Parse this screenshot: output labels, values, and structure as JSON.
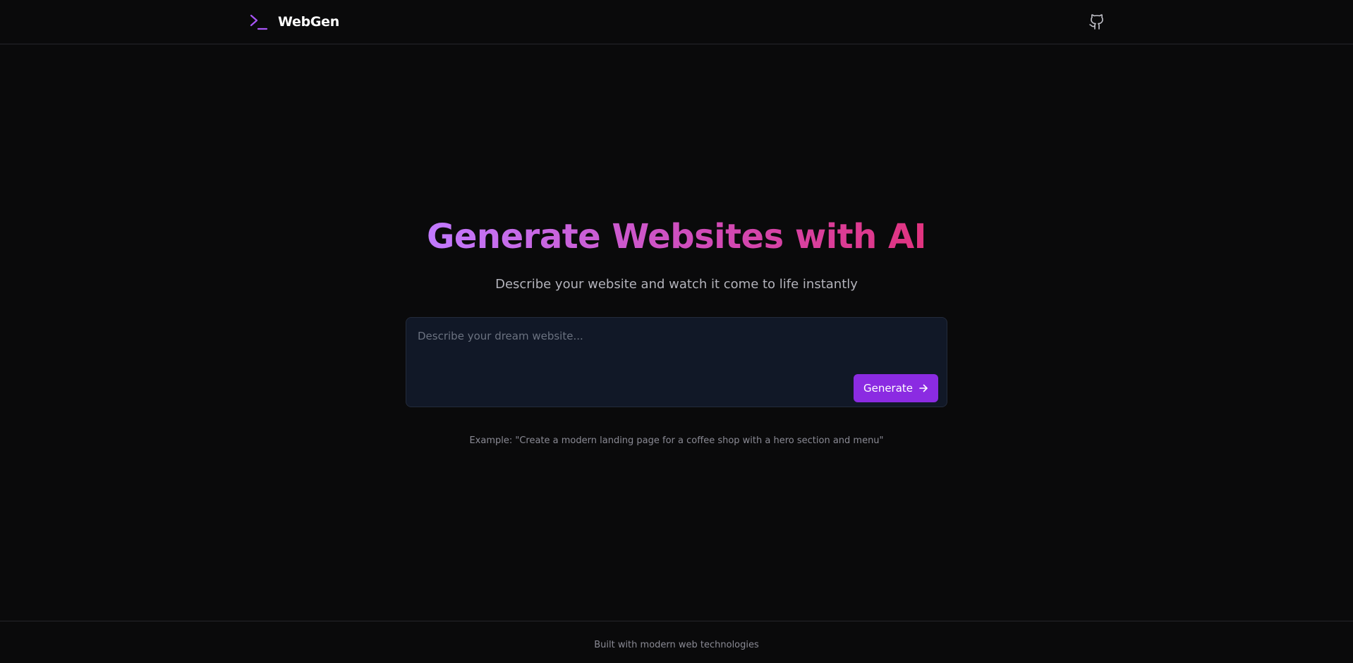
{
  "header": {
    "brand_name": "WebGen",
    "brand_icon": "terminal-prompt-icon",
    "github_icon": "github-icon"
  },
  "hero": {
    "title": "Generate Websites with AI",
    "subtitle": "Describe your website and watch it come to life instantly"
  },
  "prompt": {
    "value": "",
    "placeholder": "Describe your dream website...",
    "generate_label": "Generate",
    "generate_icon": "arrow-right-icon"
  },
  "example_text": "Example: \"Create a modern landing page for a coffee shop with a hero section and menu\"",
  "footer": {
    "text": "Built with modern web technologies"
  },
  "colors": {
    "background": "#0a0a0b",
    "accent": "#8b2be2",
    "brand_icon": "#a855f7",
    "gradient_start": "#c27aff",
    "gradient_end": "#e1337f",
    "input_background": "#111827"
  }
}
